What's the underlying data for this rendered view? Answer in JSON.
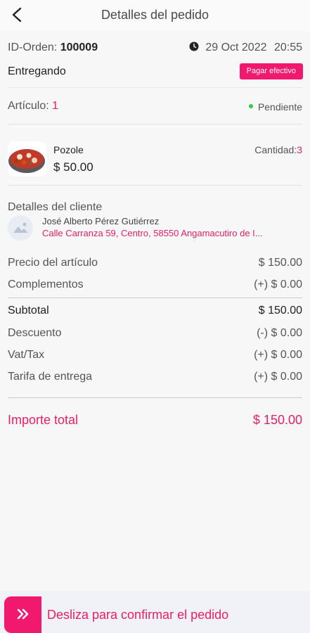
{
  "header": {
    "title": "Detalles del pedido"
  },
  "order": {
    "id_label": "ID-Orden:",
    "id_value": "100009",
    "date": "29 Oct 2022",
    "time": "20:55",
    "status": "Entregando",
    "payment_badge": "Pagar efectivo",
    "item_label": "Artículo:",
    "item_count": "1",
    "item_status": "Pendiente"
  },
  "product": {
    "name": "Pozole",
    "price": "$ 50.00",
    "qty_label": "Cantidad:",
    "qty_value": "3"
  },
  "customer": {
    "section_title": "Detalles del cliente",
    "name": "José Alberto Pérez Gutiérrez",
    "address": "Calle Carranza 59, Centro, 58550 Angamacutiro de I..."
  },
  "summary": {
    "item_price_label": "Precio del artículo",
    "item_price_value": "$ 150.00",
    "addons_label": "Complementos",
    "addons_value": "(+) $ 0.00",
    "subtotal_label": "Subtotal",
    "subtotal_value": "$ 150.00",
    "discount_label": "Descuento",
    "discount_value": "(-) $ 0.00",
    "tax_label": "Vat/Tax",
    "tax_value": "(+) $ 0.00",
    "delivery_label": "Tarifa de entrega",
    "delivery_value": "(+) $ 0.00",
    "total_label": "Importe total",
    "total_value": "$ 150.00"
  },
  "footer": {
    "swipe_text": "Desliza para confirmar el pedido"
  },
  "colors": {
    "accent": "#f0196e",
    "pending": "#2ecc40"
  }
}
